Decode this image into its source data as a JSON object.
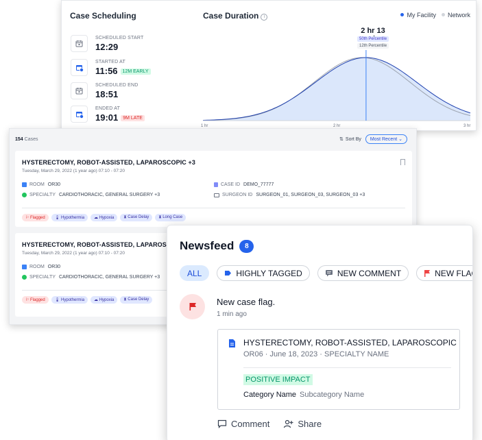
{
  "scheduling": {
    "title": "Case Scheduling",
    "rows": [
      {
        "label": "SCHEDULED START",
        "value": "12:29",
        "pill": "",
        "pill_type": ""
      },
      {
        "label": "STARTED AT",
        "value": "11:56",
        "pill": "12M EARLY",
        "pill_type": "early"
      },
      {
        "label": "SCHEDULED END",
        "value": "18:51",
        "pill": "",
        "pill_type": ""
      },
      {
        "label": "ENDED AT",
        "value": "19:01",
        "pill": "9M LATE",
        "pill_type": "late"
      }
    ]
  },
  "duration": {
    "title": "Case Duration",
    "legend": [
      {
        "label": "My Facility",
        "color": "#2563eb"
      },
      {
        "label": "Network",
        "color": "#d1d5db"
      }
    ],
    "marker_value": "2 hr 13 min",
    "percentile_primary": "50th Percentile",
    "percentile_secondary": "12th Percentile",
    "x_ticks": [
      "1 hr",
      "2 hr",
      "3 hr"
    ]
  },
  "chart_data": {
    "type": "area",
    "title": "Case Duration",
    "xlabel": "",
    "ylabel": "",
    "xlim": [
      1,
      3
    ],
    "x_ticks": [
      "1 hr",
      "2 hr",
      "3 hr"
    ],
    "grid": false,
    "legend_position": "top-right",
    "series": [
      {
        "name": "My Facility",
        "distribution": "normal",
        "mean_hr": 2.22,
        "sd_hr": 0.38,
        "color": "#2563eb"
      },
      {
        "name": "Network",
        "distribution": "normal",
        "mean_hr": 2.19,
        "sd_hr": 0.36,
        "color": "#9ca3af"
      }
    ],
    "marker": {
      "x_hr": 2.22,
      "label": "2 hr 13 min"
    }
  },
  "cases": {
    "count": "154",
    "count_label": "Cases",
    "sort_label": "Sort By",
    "sort_value": "Most Recent",
    "items": [
      {
        "title": "HYSTERECTOMY, ROBOT-ASSISTED, LAPAROSCOPIC +3",
        "date": "Tuesday, March 29, 2022 (1 year ago) 07:10 - 07:20",
        "room_label": "ROOM",
        "room": "OR30",
        "specialty_label": "SPECIALTY",
        "specialty": "CARDIOTHORACIC, GENERAL SURGERY +3",
        "case_id_label": "CASE ID",
        "case_id": "DEMO_77777",
        "surgeon_label": "SURGEON ID",
        "surgeon": "SURGEON_01, SURGEON_03, SURGEON_03 +3",
        "tags": [
          "Flagged",
          "Hypothermia",
          "Hypoxia",
          "Case Delay",
          "Long Case"
        ]
      },
      {
        "title": "HYSTERECTOMY, ROBOT-ASSISTED, LAPAROS",
        "date": "Tuesday, March 29, 2022 (1 year ago) 07:10 - 07:20",
        "room_label": "ROOM",
        "room": "OR30",
        "specialty_label": "SPECIALTY",
        "specialty": "CARDIOTHORACIC, GENERAL SURGERY +3",
        "tags": [
          "Flagged",
          "Hypothermia",
          "Hypoxia",
          "Case Delay"
        ]
      }
    ]
  },
  "newsfeed": {
    "title": "Newsfeed",
    "badge": "8",
    "filters": [
      "ALL",
      "HIGHLY TAGGED",
      "NEW COMMENT",
      "NEW FLAG"
    ],
    "notification": {
      "title": "New case flag.",
      "time": "1 min ago",
      "case_title": "HYSTERECTOMY, ROBOT-ASSISTED, LAPAROSCOPIC",
      "case_sub": "OR06 · June 18, 2023 · SPECIALTY NAME",
      "impact": "POSITIVE IMPACT",
      "category": "Category Name",
      "subcategory": "Subcategory Name"
    },
    "actions": [
      "Comment",
      "Share"
    ]
  }
}
